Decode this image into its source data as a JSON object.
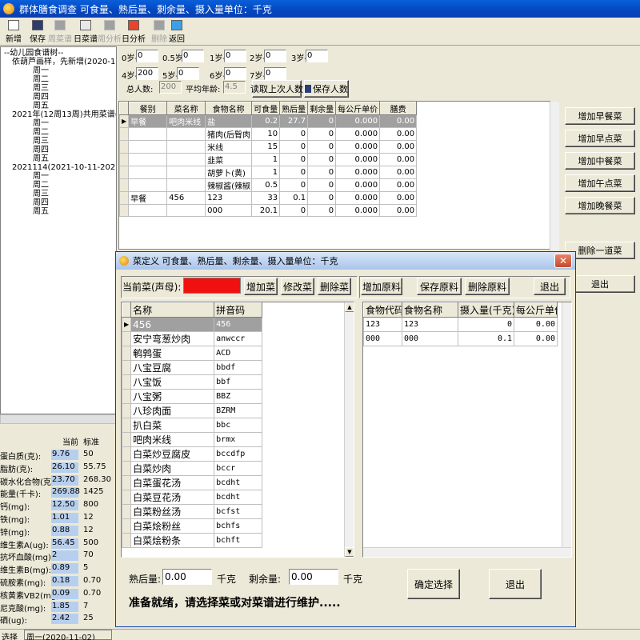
{
  "app": {
    "title": "群体膳食调查   可食量、熟后量、剩余量、摄入量单位：千克"
  },
  "toolbar": [
    {
      "label": "新增",
      "disabled": false,
      "icon": "new-file-icon"
    },
    {
      "label": "保存",
      "disabled": false,
      "icon": "save-disk-icon"
    },
    {
      "label": "周菜谱",
      "disabled": true,
      "icon": "week-menu-icon"
    },
    {
      "label": "日菜谱",
      "disabled": false,
      "icon": "day-menu-icon"
    },
    {
      "label": "周分析",
      "disabled": true,
      "icon": "week-analysis-icon"
    },
    {
      "label": "日分析",
      "disabled": false,
      "icon": "day-analysis-icon"
    },
    {
      "label": "删除",
      "disabled": true,
      "icon": "delete-icon"
    },
    {
      "label": "返回",
      "disabled": false,
      "icon": "return-icon"
    }
  ],
  "tree": {
    "root": "--幼儿园食谱树--",
    "groups": [
      {
        "label": "依葫芦画样，先新增(2020-11-",
        "days": [
          "周一",
          "周二",
          "周三",
          "周四",
          "周五"
        ]
      },
      {
        "label": "2021年(12周13周)共用菜谱(20",
        "days": [
          "周一",
          "周二",
          "周三",
          "周四",
          "周五"
        ]
      },
      {
        "label": "2021114(2021-10-11-2021-10-1",
        "days": [
          "周一",
          "周二",
          "周三",
          "周四",
          "周五"
        ]
      }
    ]
  },
  "ages": [
    {
      "label": "0岁-",
      "value": "0"
    },
    {
      "label": "0.5岁-",
      "value": "0"
    },
    {
      "label": "1岁-",
      "value": "0"
    },
    {
      "label": "2岁-",
      "value": "0"
    },
    {
      "label": "3岁-",
      "value": "0"
    },
    {
      "label": "4岁-",
      "value": "200"
    },
    {
      "label": "5岁-",
      "value": "0"
    },
    {
      "label": "6岁-",
      "value": "0"
    },
    {
      "label": "7岁-",
      "value": "0"
    }
  ],
  "summary": {
    "total_label": "总人数:",
    "total_value": "200",
    "avg_label": "平均年龄:",
    "avg_value": "4.5",
    "load_btn": "读取上次人数",
    "save_btn": "保存人数"
  },
  "grid": {
    "headers": [
      "餐别",
      "菜名称",
      "食物名称",
      "可食量",
      "熟后量",
      "剩余量",
      "每公斤单价",
      "膳费"
    ],
    "rows": [
      [
        "早餐",
        "吧肉米线",
        "盐",
        "0.2",
        "27.7",
        "0",
        "0.000",
        "0.00"
      ],
      [
        "",
        "",
        "猪肉(后臀肉",
        "10",
        "0",
        "0",
        "0.000",
        "0.00"
      ],
      [
        "",
        "",
        "米线",
        "15",
        "0",
        "0",
        "0.000",
        "0.00"
      ],
      [
        "",
        "",
        "韭菜",
        "1",
        "0",
        "0",
        "0.000",
        "0.00"
      ],
      [
        "",
        "",
        "胡萝卜(黄)",
        "1",
        "0",
        "0",
        "0.000",
        "0.00"
      ],
      [
        "",
        "",
        "辣椒酱(辣椒",
        "0.5",
        "0",
        "0",
        "0.000",
        "0.00"
      ],
      [
        "早餐",
        "456",
        "123",
        "33",
        "0.1",
        "0",
        "0.000",
        "0.00"
      ],
      [
        "",
        "",
        "000",
        "20.1",
        "0",
        "0",
        "0.000",
        "0.00"
      ]
    ]
  },
  "right_buttons": [
    "增加早餐菜",
    "增加早点菜",
    "增加中餐菜",
    "增加午点菜",
    "增加晚餐菜",
    "删除一道菜",
    "退出"
  ],
  "nutrition": {
    "header_current": "当前",
    "header_standard": "标准",
    "rows": [
      {
        "name": "蛋白质(克):",
        "cur": "9.76",
        "std": "50"
      },
      {
        "name": "脂肪(克):",
        "cur": "26.10",
        "std": "55.75"
      },
      {
        "name": "碳水化合物(克):",
        "cur": "23.70",
        "std": "268.30"
      },
      {
        "name": "能量(千卡):",
        "cur": "269.88",
        "std": "1425"
      },
      {
        "name": "钙(mg):",
        "cur": "12.50",
        "std": "800"
      },
      {
        "name": "铁(mg):",
        "cur": "1.01",
        "std": "12"
      },
      {
        "name": "锌(mg):",
        "cur": "0.88",
        "std": "12"
      },
      {
        "name": "维生素A(ug):",
        "cur": "56.45",
        "std": "500"
      },
      {
        "name": "抗坏血酸(mg):",
        "cur": "2",
        "std": "70"
      },
      {
        "name": "维生素B(mg):",
        "cur": "0.89",
        "std": "5"
      },
      {
        "name": "硫胺素(mg):",
        "cur": "0.18",
        "std": "0.70"
      },
      {
        "name": "核黄素VB2(mg):",
        "cur": "0.09",
        "std": "0.70"
      },
      {
        "name": "尼克酸(mg):",
        "cur": "1.85",
        "std": "7"
      },
      {
        "name": "硒(ug):",
        "cur": "2.42",
        "std": "25"
      }
    ]
  },
  "status": {
    "left": "选择",
    "right": "周一(2020-11-02)"
  },
  "dialog": {
    "title": "菜定义  可食量、熟后量、剩余量、摄入量单位：千克",
    "current_label": "当前菜(声母):",
    "current_value": "",
    "btn_add_dish": "增加菜",
    "btn_edit_dish": "修改菜",
    "btn_del_dish": "删除菜",
    "btn_add_mat": "增加原料",
    "btn_save_mat": "保存原料",
    "btn_del_mat": "删除原料",
    "btn_exit_top": "退出",
    "dish_headers": [
      "名称",
      "拼音码"
    ],
    "dishes": [
      [
        "456",
        "456"
      ],
      [
        "安宁弯葱炒肉",
        "anwccr"
      ],
      [
        "鹌鹑蛋",
        "ACD"
      ],
      [
        "八宝豆腐",
        "bbdf"
      ],
      [
        "八宝饭",
        "bbf"
      ],
      [
        "八宝粥",
        "BBZ"
      ],
      [
        "八珍肉面",
        "BZRM"
      ],
      [
        "扒白菜",
        "bbc"
      ],
      [
        "吧肉米线",
        "brmx"
      ],
      [
        "白菜炒豆腐皮",
        "bccdfp"
      ],
      [
        "白菜炒肉",
        "bccr"
      ],
      [
        "白菜蛋花汤",
        "bcdht"
      ],
      [
        "白菜豆花汤",
        "bcdht"
      ],
      [
        "白菜粉丝汤",
        "bcfst"
      ],
      [
        "白菜烩粉丝",
        "bchfs"
      ],
      [
        "白菜烩粉条",
        "bchft"
      ]
    ],
    "mat_headers": [
      "食物代码",
      "食物名称",
      "摄入量(千克)",
      "每公斤单价"
    ],
    "materials": [
      [
        "123",
        "123",
        "0",
        "0.00"
      ],
      [
        "000",
        "000",
        "0.1",
        "0.00"
      ]
    ],
    "cooked_label": "熟后量:",
    "cooked_value": "0.00",
    "cooked_unit": "千克",
    "remain_label": "剩余量:",
    "remain_value": "0.00",
    "remain_unit": "千克",
    "btn_confirm": "确定选择",
    "btn_exit_bottom": "退出",
    "status_msg": "准备就绪，请选择菜或对菜谱进行维护....."
  }
}
